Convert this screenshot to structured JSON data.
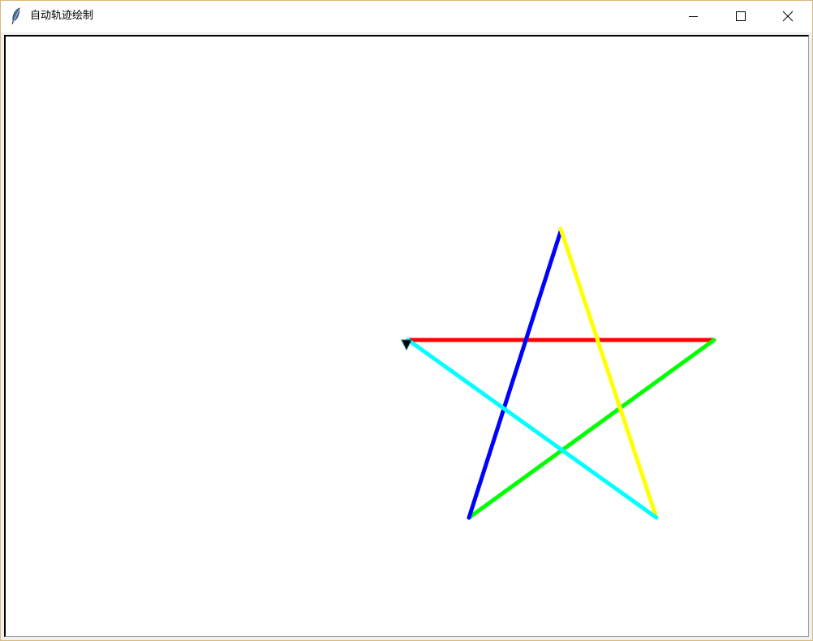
{
  "window": {
    "title": "自动轨迹绘制",
    "icon": "feather-icon",
    "controls": {
      "minimize": "minimize-icon",
      "maximize": "maximize-icon",
      "close": "close-icon"
    }
  },
  "canvas": {
    "background": "#ffffff",
    "star_segments": [
      {
        "name": "segment-red",
        "color": "#ff0000"
      },
      {
        "name": "segment-green",
        "color": "#00ff00"
      },
      {
        "name": "segment-blue",
        "color": "#0000ff"
      },
      {
        "name": "segment-yellow",
        "color": "#ffff00"
      },
      {
        "name": "segment-cyan",
        "color": "#00ffff"
      }
    ],
    "cursor": "turtle-arrow-icon"
  }
}
